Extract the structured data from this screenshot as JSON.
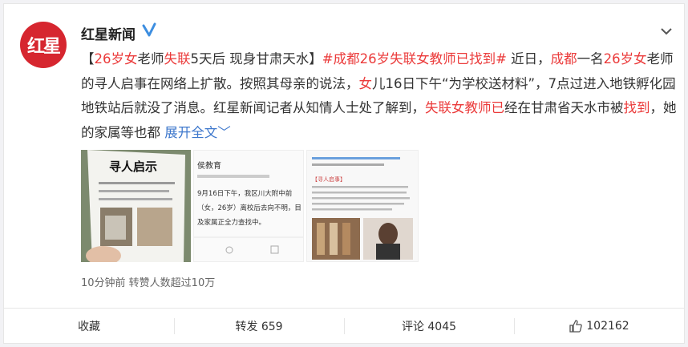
{
  "post": {
    "author": "红星新闻",
    "avatar_text": "红星",
    "body": [
      {
        "t": "【"
      },
      {
        "t": "26岁女",
        "c": "red"
      },
      {
        "t": "老师"
      },
      {
        "t": "失联",
        "c": "red"
      },
      {
        "t": "5天后 现身甘肃天水】"
      },
      {
        "t": "#成都26岁失联女教师已找到#",
        "c": "red"
      },
      {
        "t": " 近日，"
      },
      {
        "t": "成都",
        "c": "red"
      },
      {
        "t": "一名"
      },
      {
        "t": "26岁女",
        "c": "red"
      },
      {
        "t": "老师的寻人启事在网络上扩散。按照其母亲的说法，"
      },
      {
        "t": "女",
        "c": "red"
      },
      {
        "t": "儿16日下午“为学校送材料”，7点过进入地铁孵化园地铁站后就没了消息。红星新闻记者从知情人士处了解到，"
      },
      {
        "t": "失联女教师已",
        "c": "red"
      },
      {
        "t": "经在甘肃省天水市被"
      },
      {
        "t": "找到",
        "c": "red"
      },
      {
        "t": "，她的家属等也都 "
      },
      {
        "t": "展开全文",
        "c": "blue"
      }
    ],
    "meta": "10分钟前 转赞人数超过10万"
  },
  "images": {
    "img1": {
      "title": "寻人启示"
    },
    "img2": {
      "source": "侯教育",
      "line1": "9月16日下午，我区川大附中前",
      "line2": "（女，26岁）离校后去向不明，目",
      "line3": "及家属正全力查找中。"
    },
    "img3": {
      "notice": "【寻人启事】"
    }
  },
  "actions": {
    "favorite": "收藏",
    "repost": "转发 659",
    "comment": "评论 4045",
    "like": "102162"
  },
  "colors": {
    "accent_red": "#eb3a3a",
    "link_blue": "#3d77cc",
    "brand": "#d6262f"
  }
}
